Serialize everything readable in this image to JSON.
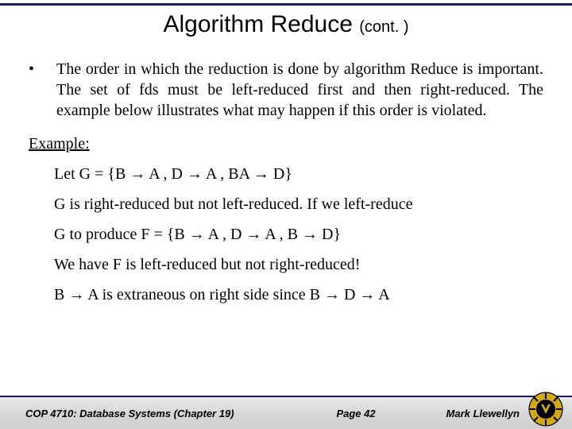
{
  "title": {
    "main": "Algorithm Reduce ",
    "cont": "(cont. )"
  },
  "bullet": {
    "mark": "•",
    "text": "The order in which the reduction is done by algorithm Reduce is important.  The set of fds must be left-reduced first and then right-reduced.   The example below illustrates what may happen if this order is violated."
  },
  "example": {
    "label": "Example:",
    "lines": [
      "Let G = {B → A , D → A , BA → D}",
      "G is right-reduced but not left-reduced.  If we left-reduce",
      "G to produce F = {B → A , D → A , B → D}",
      "We have F is left-reduced but not right-reduced!",
      "B → A is extraneous on right side since B → D  → A"
    ]
  },
  "footer": {
    "left": "COP 4710: Database Systems  (Chapter 19)",
    "center": "Page 42",
    "right": "Mark Llewellyn"
  }
}
